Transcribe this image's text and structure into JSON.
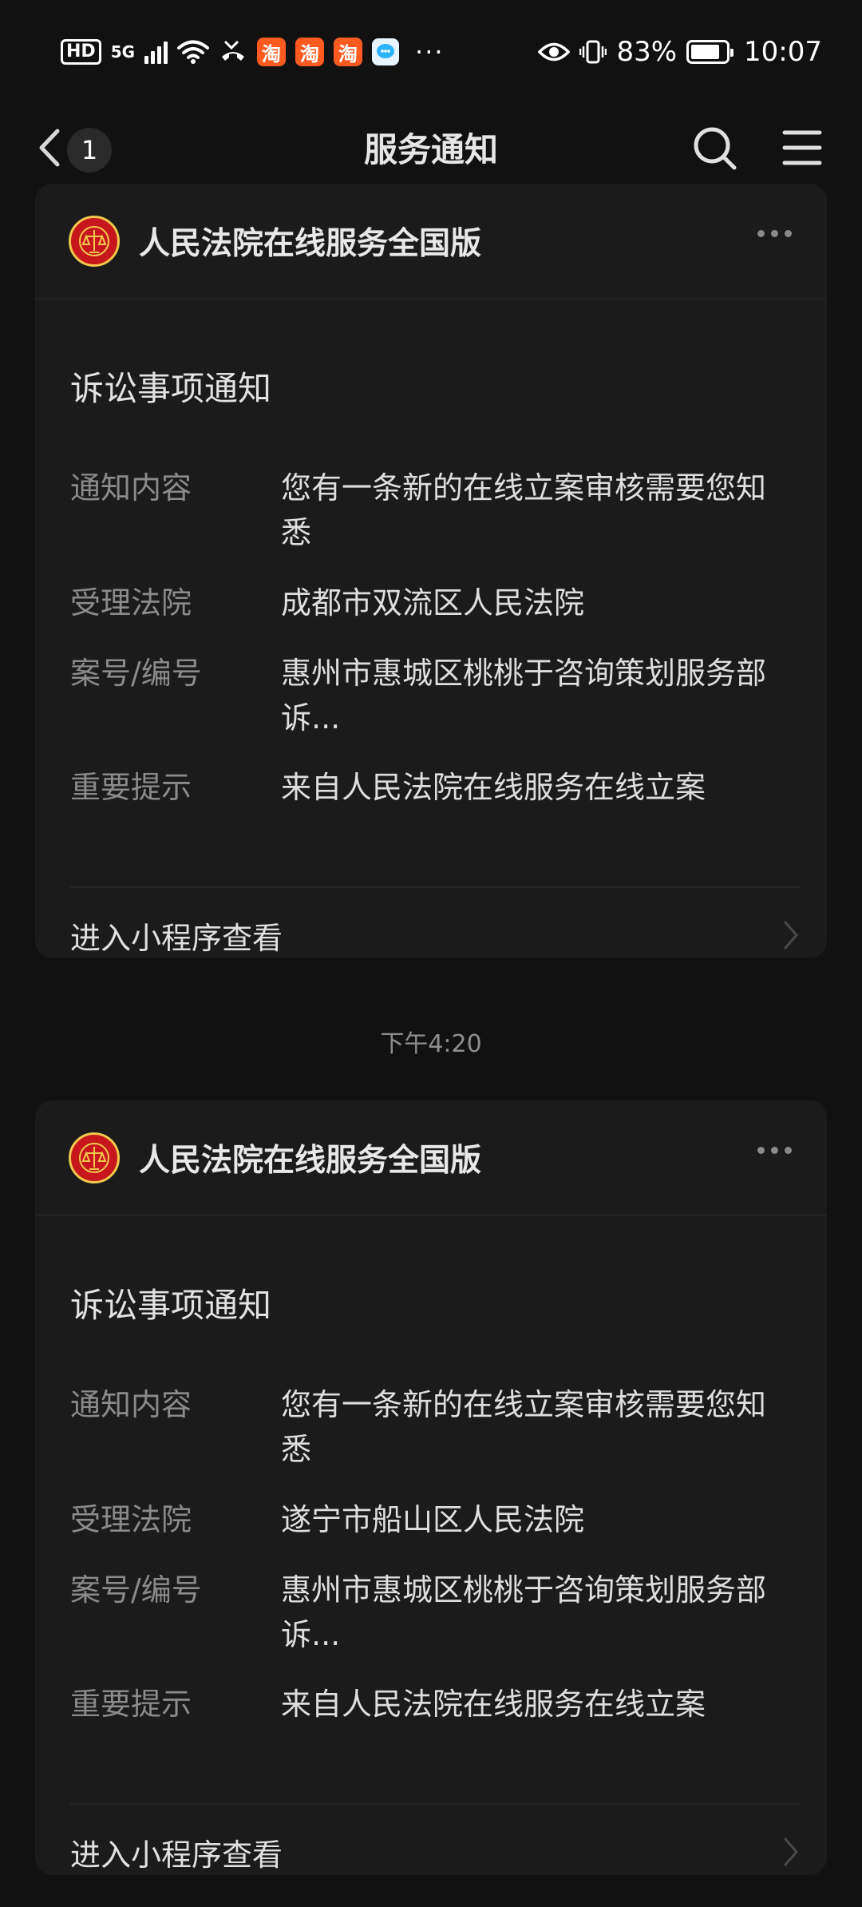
{
  "status_bar": {
    "hd": "HD",
    "network": "5G",
    "taobao_glyph": "淘",
    "more": "···",
    "battery_percent": "83%",
    "battery_level": 0.83,
    "time": "10:07"
  },
  "nav": {
    "unread_count": "1",
    "title": "服务通知"
  },
  "messages": [
    {
      "app_name": "人民法院在线服务全国版",
      "notice_title": "诉讼事项通知",
      "rows": [
        {
          "label": "通知内容",
          "value": "您有一条新的在线立案审核需要您知悉"
        },
        {
          "label": "受理法院",
          "value": "成都市双流区人民法院"
        },
        {
          "label": "案号/编号",
          "value": "惠州市惠城区桃桃于咨询策划服务部诉..."
        },
        {
          "label": "重要提示",
          "value": "来自人民法院在线服务在线立案"
        }
      ],
      "footer": "进入小程序查看"
    },
    {
      "timestamp": "下午4:20",
      "app_name": "人民法院在线服务全国版",
      "notice_title": "诉讼事项通知",
      "rows": [
        {
          "label": "通知内容",
          "value": "您有一条新的在线立案审核需要您知悉"
        },
        {
          "label": "受理法院",
          "value": "遂宁市船山区人民法院"
        },
        {
          "label": "案号/编号",
          "value": "惠州市惠城区桃桃于咨询策划服务部诉..."
        },
        {
          "label": "重要提示",
          "value": "来自人民法院在线服务在线立案"
        }
      ],
      "footer": "进入小程序查看"
    }
  ],
  "colors": {
    "background": "#111111",
    "card": "#1b1b1b",
    "label": "#8b8b8b",
    "value": "#dedede",
    "court_red": "#c8161d"
  }
}
